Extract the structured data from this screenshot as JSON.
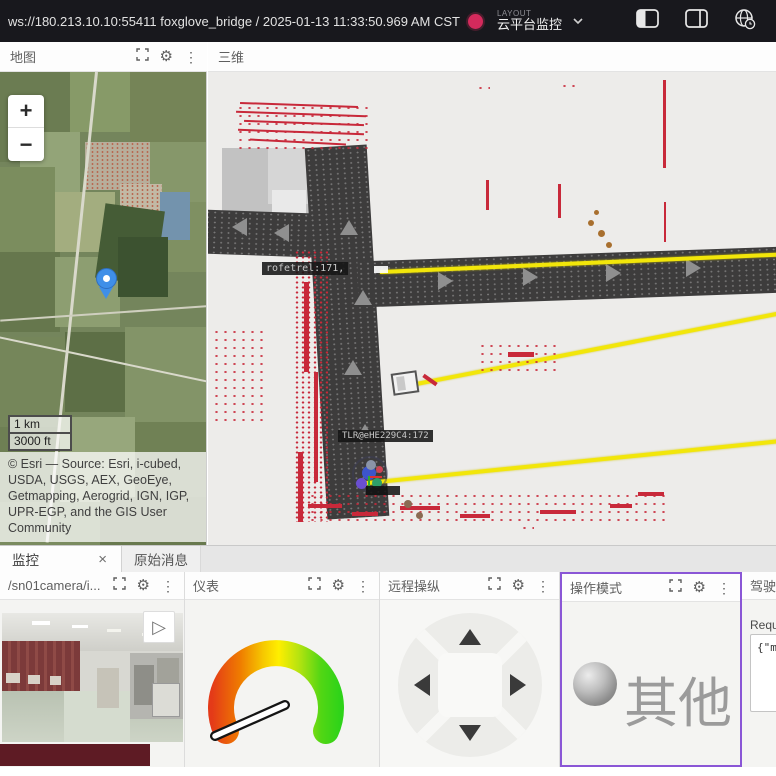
{
  "top_bar": {
    "connection_text": "ws://180.213.10.10:55411 foxglove_bridge / 2025-01-13 11:33:50.969 AM CST",
    "layout_label": "LAYOUT",
    "layout_name": "云平台监控"
  },
  "colors": {
    "status_red": "#d42a5c",
    "accent_purple": "#8a56d6",
    "path_yellow": "#f2e60a",
    "lidar_red": "#c8293a"
  },
  "icons": {
    "gear": "⚙",
    "kebab": "⋮",
    "close": "×",
    "play": "▷"
  },
  "map_panel": {
    "title": "地图",
    "zoom_in_label": "+",
    "zoom_out_label": "−",
    "scale_km": "1 km",
    "scale_ft": "3000 ft",
    "attribution": "© Esri — Source: Esri, i-cubed, USDA, USGS, AEX, GeoEye, Getmapping, Aerogrid, IGN, IGP, UPR-EGP, and the GIS User Community"
  },
  "scene_panel": {
    "title": "三维",
    "object_label_1": "rofetrel:171,",
    "object_label_2": "TLR@eHE229C4:172"
  },
  "tab_bar": {
    "active_tab": "监控",
    "inactive_tab": "原始消息"
  },
  "camera_panel": {
    "title": "/sn01camera/i..."
  },
  "gauge_panel": {
    "title": "仪表"
  },
  "teleop_panel": {
    "title": "远程操纵"
  },
  "mode_panel": {
    "title": "操作模式",
    "mode_value": "其他"
  },
  "drive_panel": {
    "title": "驾驶模式",
    "request_label": "Request",
    "request_value": "{\"m"
  }
}
